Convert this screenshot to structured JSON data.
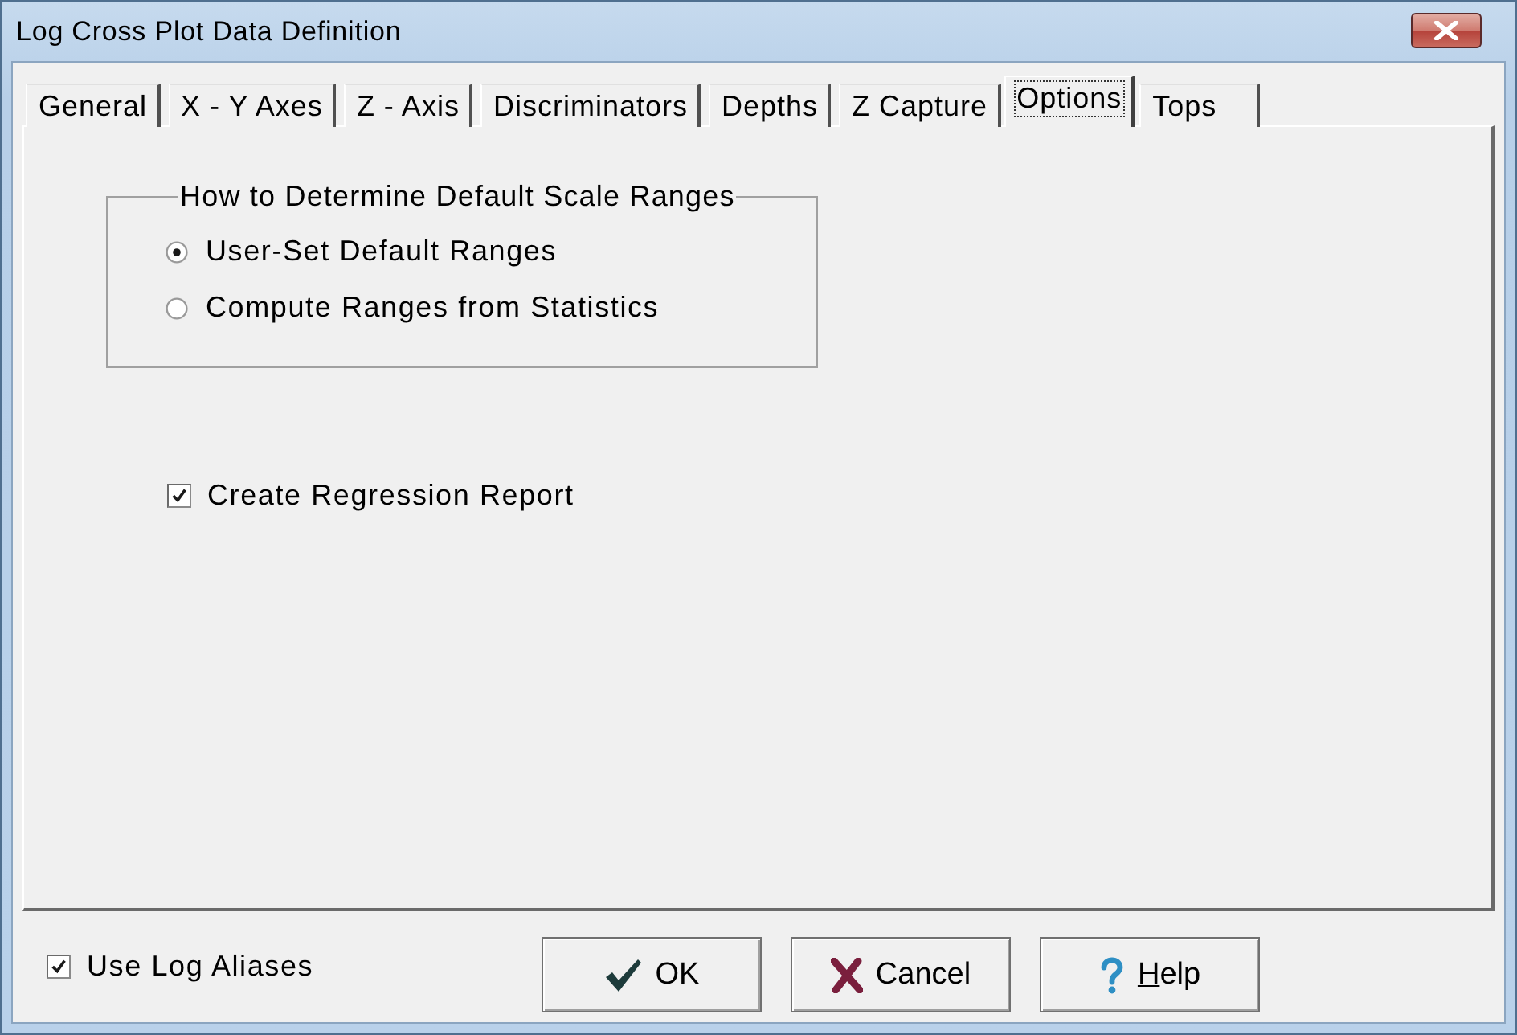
{
  "window": {
    "title": "Log Cross Plot Data Definition"
  },
  "tabs": [
    {
      "label": "General",
      "selected": false
    },
    {
      "label": "X - Y Axes",
      "selected": false
    },
    {
      "label": "Z - Axis",
      "selected": false
    },
    {
      "label": "Discriminators",
      "selected": false
    },
    {
      "label": "Depths",
      "selected": false
    },
    {
      "label": "Z Capture",
      "selected": false
    },
    {
      "label": "Options",
      "selected": true
    },
    {
      "label": "Tops",
      "selected": false
    }
  ],
  "scale_ranges_group": {
    "title": "How to Determine Default Scale Ranges",
    "options": [
      {
        "label": "User-Set Default Ranges",
        "selected": true
      },
      {
        "label": "Compute Ranges from Statistics",
        "selected": false
      }
    ]
  },
  "regression_report": {
    "label": "Create Regression Report",
    "checked": true
  },
  "use_log_aliases": {
    "label": "Use Log Aliases",
    "checked": true
  },
  "buttons": [
    {
      "kind": "ok",
      "label": "OK",
      "access_key_underlined": false
    },
    {
      "kind": "cancel",
      "label": "Cancel",
      "access_key_underlined": false
    },
    {
      "kind": "help",
      "label": "Help",
      "access_key_underlined": true
    }
  ]
}
